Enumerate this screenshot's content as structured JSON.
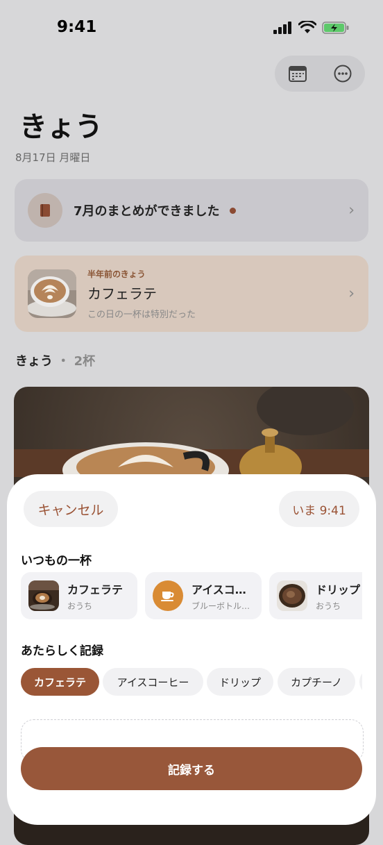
{
  "status_bar": {
    "time": "9:41"
  },
  "header": {
    "title": "きょう",
    "date": "8月17日 月曜日",
    "icons": [
      "calendar-icon",
      "more-icon"
    ]
  },
  "summary_card": {
    "text": "7月のまとめができました"
  },
  "memory_card": {
    "subtitle": "半年前のきょう",
    "title": "カフェラテ",
    "description": "この日の一杯は特別だった"
  },
  "today_section": {
    "title": "きょう",
    "separator": "・",
    "count": "2杯"
  },
  "sheet": {
    "cancel_label": "キャンセル",
    "time_label": "いま 9:41",
    "favorites_title": "いつもの一杯",
    "favorites": [
      {
        "name": "カフェラテ",
        "place": "おうち"
      },
      {
        "name": "アイスコ…",
        "place": "ブルーボトル…"
      },
      {
        "name": "ドリップ",
        "place": "おうち"
      }
    ],
    "new_title": "あたらしく記録",
    "chips": [
      "カフェラテ",
      "アイスコーヒー",
      "ドリップ",
      "カプチーノ"
    ],
    "submit_label": "記録する"
  },
  "colors": {
    "accent": "#98573a",
    "memory_bg": "#d8c8bc",
    "summary_dot": "#8b4a32",
    "iced_coffee_icon": "#d98b34"
  }
}
